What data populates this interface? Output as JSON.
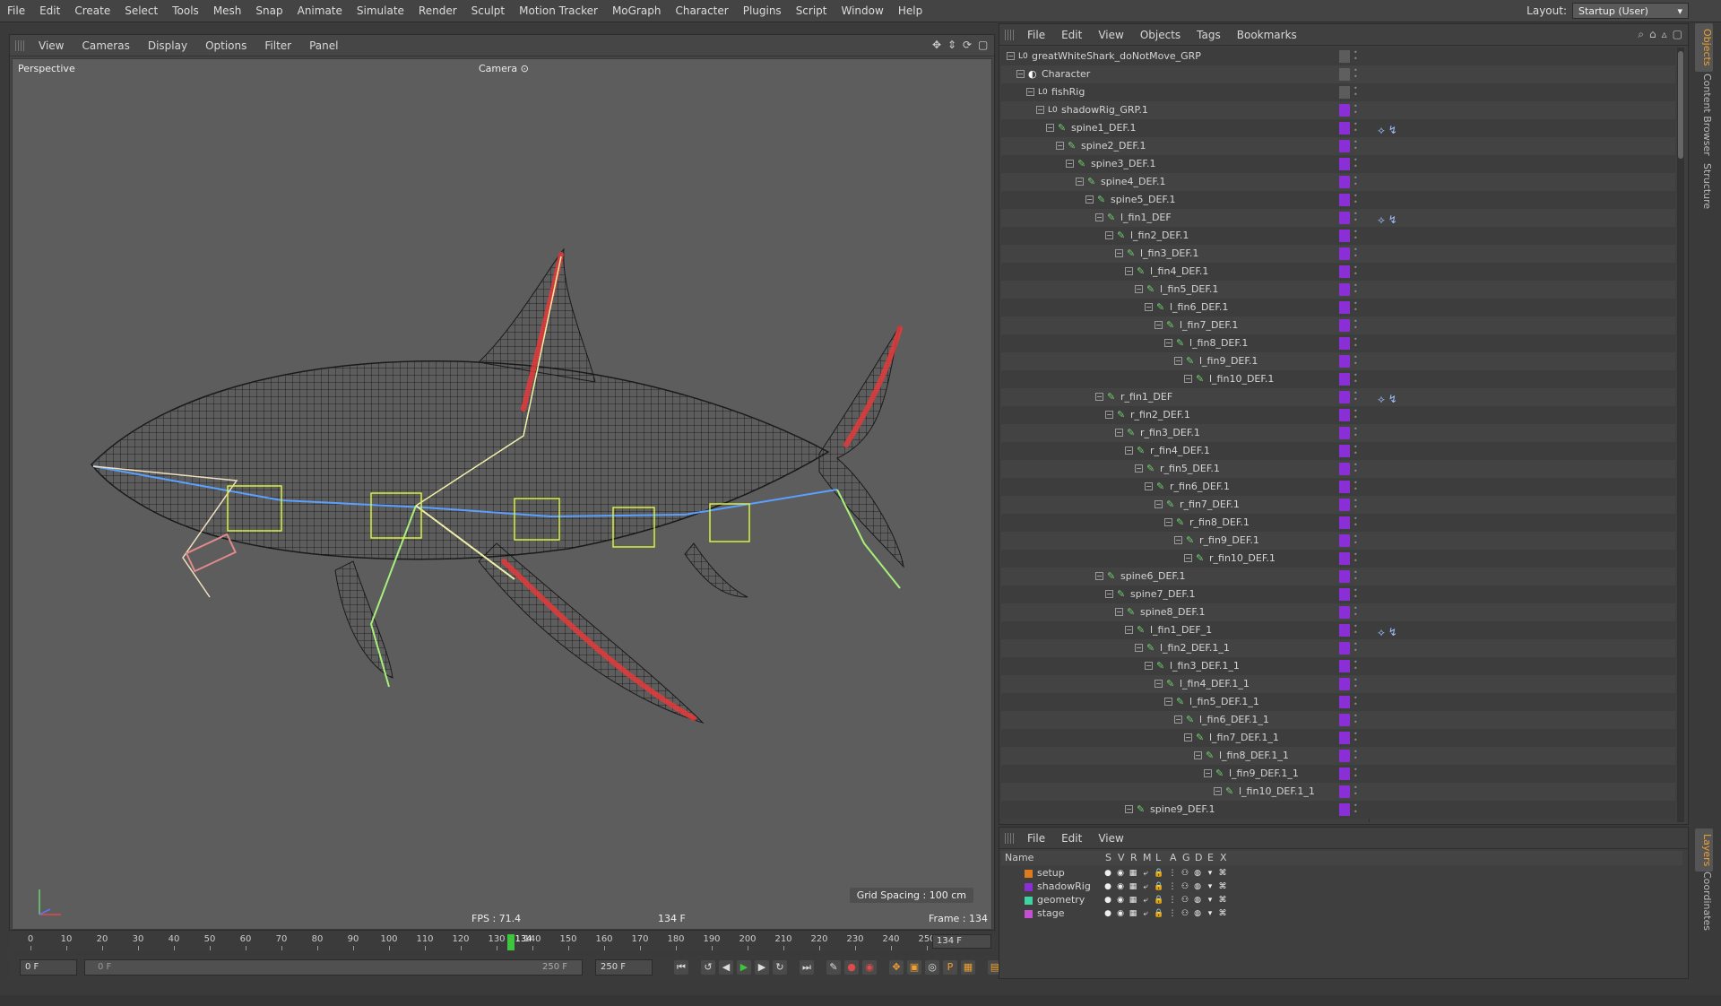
{
  "menu": [
    "File",
    "Edit",
    "Create",
    "Select",
    "Tools",
    "Mesh",
    "Snap",
    "Animate",
    "Simulate",
    "Render",
    "Sculpt",
    "Motion Tracker",
    "MoGraph",
    "Character",
    "Plugins",
    "Script",
    "Window",
    "Help"
  ],
  "layout": {
    "label": "Layout:",
    "value": "Startup (User)"
  },
  "viewport": {
    "menu": [
      "View",
      "Cameras",
      "Display",
      "Options",
      "Filter",
      "Panel"
    ],
    "projection": "Perspective",
    "camera": "Camera",
    "grid_spacing": "Grid Spacing : 100 cm",
    "fps": "FPS : 71.4",
    "frame_mid": "134 F",
    "frame_right": "Frame : 134"
  },
  "timeline": {
    "ticks": [
      "0",
      "10",
      "20",
      "30",
      "40",
      "50",
      "60",
      "70",
      "80",
      "90",
      "100",
      "110",
      "120",
      "130",
      "140",
      "150",
      "160",
      "170",
      "180",
      "190",
      "200",
      "210",
      "220",
      "230",
      "240",
      "250"
    ],
    "playhead_frame": 134,
    "playhead_label": "134",
    "max_frame": 250,
    "current": "134 F"
  },
  "transport": {
    "start": "0 F",
    "range_left": "0 F",
    "range_right": "250 F",
    "end": "250 F"
  },
  "object_manager": {
    "menu": [
      "File",
      "Edit",
      "View",
      "Objects",
      "Tags",
      "Bookmarks"
    ],
    "rows": [
      {
        "name": "greatWhiteShark_doNotMove_GRP",
        "depth": 0,
        "icon": "null-icon",
        "layer": false
      },
      {
        "name": "Character",
        "depth": 1,
        "icon": "character-icon",
        "layer": false
      },
      {
        "name": "fishRig",
        "depth": 2,
        "icon": "null-icon",
        "layer": false
      },
      {
        "name": "shadowRig_GRP.1",
        "depth": 3,
        "icon": "null-icon",
        "layer": true
      },
      {
        "name": "spine1_DEF.1",
        "depth": 4,
        "icon": "joint-icon",
        "layer": true,
        "tag": true
      },
      {
        "name": "spine2_DEF.1",
        "depth": 5,
        "icon": "joint-icon",
        "layer": true
      },
      {
        "name": "spine3_DEF.1",
        "depth": 6,
        "icon": "joint-icon",
        "layer": true
      },
      {
        "name": "spine4_DEF.1",
        "depth": 7,
        "icon": "joint-icon",
        "layer": true
      },
      {
        "name": "spine5_DEF.1",
        "depth": 8,
        "icon": "joint-icon",
        "layer": true
      },
      {
        "name": "l_fin1_DEF",
        "depth": 9,
        "icon": "joint-icon",
        "layer": true,
        "tag": true
      },
      {
        "name": "l_fin2_DEF.1",
        "depth": 10,
        "icon": "joint-icon",
        "layer": true
      },
      {
        "name": "l_fin3_DEF.1",
        "depth": 11,
        "icon": "joint-icon",
        "layer": true
      },
      {
        "name": "l_fin4_DEF.1",
        "depth": 12,
        "icon": "joint-icon",
        "layer": true
      },
      {
        "name": "l_fin5_DEF.1",
        "depth": 13,
        "icon": "joint-icon",
        "layer": true
      },
      {
        "name": "l_fin6_DEF.1",
        "depth": 14,
        "icon": "joint-icon",
        "layer": true
      },
      {
        "name": "l_fin7_DEF.1",
        "depth": 15,
        "icon": "joint-icon",
        "layer": true
      },
      {
        "name": "l_fin8_DEF.1",
        "depth": 16,
        "icon": "joint-icon",
        "layer": true
      },
      {
        "name": "l_fin9_DEF.1",
        "depth": 17,
        "icon": "joint-icon",
        "layer": true
      },
      {
        "name": "l_fin10_DEF.1",
        "depth": 18,
        "icon": "joint-icon",
        "layer": true
      },
      {
        "name": "r_fin1_DEF",
        "depth": 9,
        "icon": "joint-icon",
        "layer": true,
        "tag": true
      },
      {
        "name": "r_fin2_DEF.1",
        "depth": 10,
        "icon": "joint-icon",
        "layer": true
      },
      {
        "name": "r_fin3_DEF.1",
        "depth": 11,
        "icon": "joint-icon",
        "layer": true
      },
      {
        "name": "r_fin4_DEF.1",
        "depth": 12,
        "icon": "joint-icon",
        "layer": true
      },
      {
        "name": "r_fin5_DEF.1",
        "depth": 13,
        "icon": "joint-icon",
        "layer": true
      },
      {
        "name": "r_fin6_DEF.1",
        "depth": 14,
        "icon": "joint-icon",
        "layer": true
      },
      {
        "name": "r_fin7_DEF.1",
        "depth": 15,
        "icon": "joint-icon",
        "layer": true
      },
      {
        "name": "r_fin8_DEF.1",
        "depth": 16,
        "icon": "joint-icon",
        "layer": true
      },
      {
        "name": "r_fin9_DEF.1",
        "depth": 17,
        "icon": "joint-icon",
        "layer": true
      },
      {
        "name": "r_fin10_DEF.1",
        "depth": 18,
        "icon": "joint-icon",
        "layer": true
      },
      {
        "name": "spine6_DEF.1",
        "depth": 9,
        "icon": "joint-icon",
        "layer": true
      },
      {
        "name": "spine7_DEF.1",
        "depth": 10,
        "icon": "joint-icon",
        "layer": true
      },
      {
        "name": "spine8_DEF.1",
        "depth": 11,
        "icon": "joint-icon",
        "layer": true
      },
      {
        "name": "l_fin1_DEF_1",
        "depth": 12,
        "icon": "joint-icon",
        "layer": true,
        "tag": true
      },
      {
        "name": "l_fin2_DEF.1_1",
        "depth": 13,
        "icon": "joint-icon",
        "layer": true
      },
      {
        "name": "l_fin3_DEF.1_1",
        "depth": 14,
        "icon": "joint-icon",
        "layer": true
      },
      {
        "name": "l_fin4_DEF.1_1",
        "depth": 15,
        "icon": "joint-icon",
        "layer": true
      },
      {
        "name": "l_fin5_DEF.1_1",
        "depth": 16,
        "icon": "joint-icon",
        "layer": true
      },
      {
        "name": "l_fin6_DEF.1_1",
        "depth": 17,
        "icon": "joint-icon",
        "layer": true
      },
      {
        "name": "l_fin7_DEF.1_1",
        "depth": 18,
        "icon": "joint-icon",
        "layer": true
      },
      {
        "name": "l_fin8_DEF.1_1",
        "depth": 19,
        "icon": "joint-icon",
        "layer": true
      },
      {
        "name": "l_fin9_DEF.1_1",
        "depth": 20,
        "icon": "joint-icon",
        "layer": true
      },
      {
        "name": "l_fin10_DEF.1_1",
        "depth": 21,
        "icon": "joint-icon",
        "layer": true
      },
      {
        "name": "spine9_DEF.1",
        "depth": 12,
        "icon": "joint-icon",
        "layer": true
      }
    ]
  },
  "right_tabs": [
    "Objects",
    "Content Browser",
    "Structure"
  ],
  "right_tabs_bottom": [
    "Layers",
    "Coordinates"
  ],
  "layer_manager": {
    "menu": [
      "File",
      "Edit",
      "View"
    ],
    "columns": [
      "Name",
      "S",
      "V",
      "R",
      "M",
      "L",
      "A",
      "G",
      "D",
      "E",
      "X"
    ],
    "layers": [
      {
        "name": "setup",
        "color": "#e07a1f"
      },
      {
        "name": "shadowRig",
        "color": "#8a2fd6"
      },
      {
        "name": "geometry",
        "color": "#3fd3a4"
      },
      {
        "name": "stage",
        "color": "#c44fd0"
      }
    ]
  },
  "colors": {
    "accent_playhead": "#3ec43e",
    "layer_purple": "#8a2fd6"
  }
}
